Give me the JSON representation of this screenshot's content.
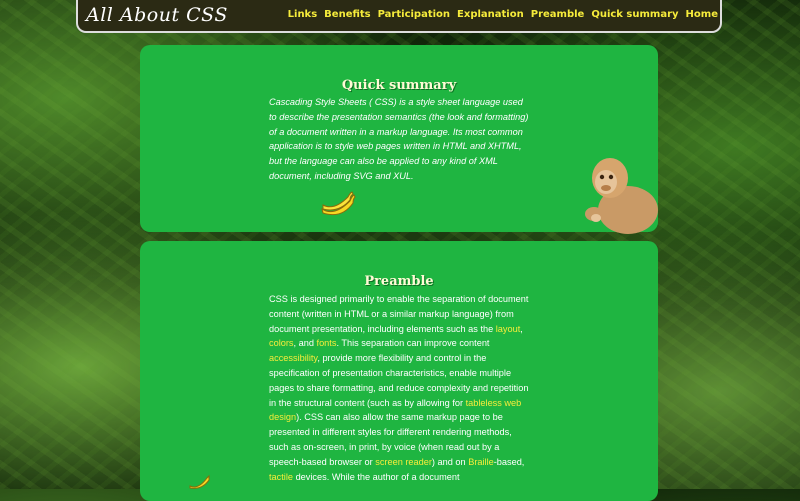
{
  "site": {
    "brand": "All About CSS"
  },
  "nav": {
    "items": [
      "Links",
      "Benefits",
      "Participation",
      "Explanation",
      "Preamble",
      "Quick summary",
      "Home"
    ]
  },
  "summary": {
    "title": "Quick summary",
    "text": "Cascading Style Sheets ( CSS) is a style sheet language used to describe the presentation semantics (the look and formatting) of a document written in a markup language. Its most common application is to style web pages written in HTML and XHTML, but the language can also be applied to any kind of XML document, including SVG and XUL."
  },
  "preamble": {
    "title": "Preamble",
    "t1": "CSS is designed primarily to enable the separation of document content (written in HTML or a similar markup language) from document presentation, including elements such as the ",
    "l1": "layout",
    "t2": ", ",
    "l2": "colors",
    "t3": ", and ",
    "l3": "fonts",
    "t4": ". This separation can improve content ",
    "l4": "accessibility",
    "t5": ", provide more flexibility and control in the specification of presentation characteristics, enable multiple pages to share formatting, and reduce complexity and repetition in the structural content (such as by allowing for ",
    "l5": "tableless web design",
    "t6": "). CSS can also allow the same markup page to be presented in different styles for different rendering methods, such as on-screen, in print, by voice (when read out by a speech-based browser or ",
    "l6": "screen reader",
    "t7": ") and on ",
    "l7": "Braille",
    "t8": "-based, ",
    "l8": "tactile",
    "t9": " devices. While the author of a document"
  },
  "colors": {
    "card": "#1fb541",
    "link": "#f6ec3b",
    "nav": "#2b2a14"
  },
  "icons": [
    "banana-icon",
    "monkey-image"
  ]
}
